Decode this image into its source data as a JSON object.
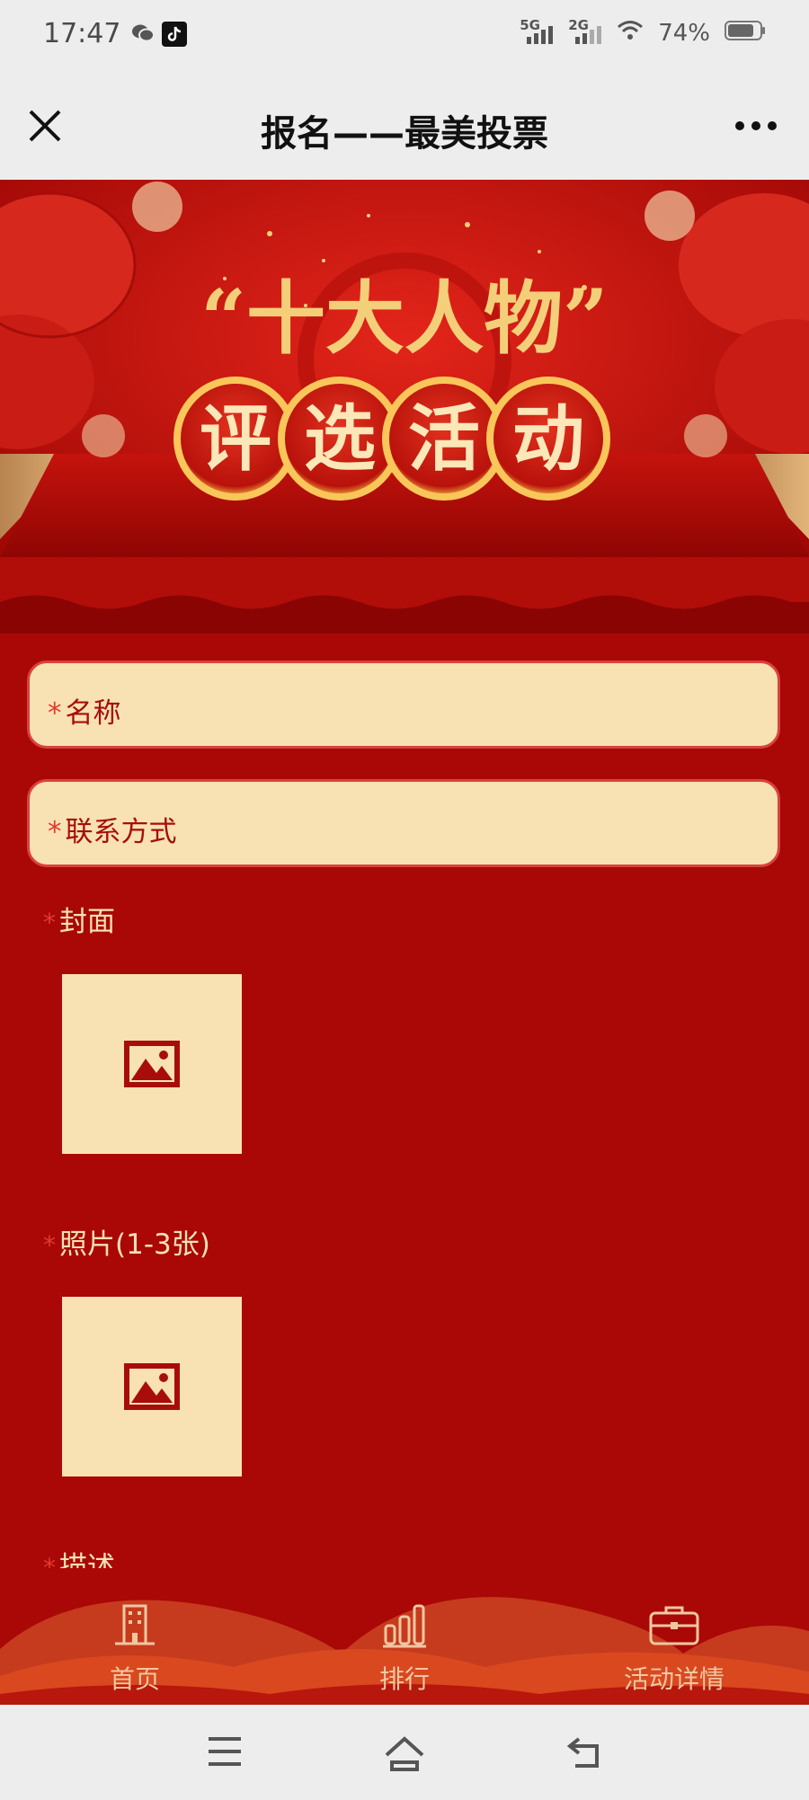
{
  "status_bar": {
    "time": "17:47",
    "network_1": "5G",
    "network_2": "2G",
    "battery": "74%",
    "icons": [
      "wechat-icon",
      "tiktok-icon",
      "signal-icon",
      "wifi-icon",
      "battery-icon"
    ]
  },
  "nav": {
    "title": "报名——最美投票",
    "close_icon": "close-icon",
    "more_icon": "more-icon"
  },
  "banner": {
    "title_line1": "“十大人物”",
    "title_line2": [
      "评",
      "选",
      "活",
      "动"
    ],
    "colors": {
      "red": "#c8140f",
      "gold": "#f4cf7a"
    }
  },
  "form": {
    "name_field": {
      "required": "*",
      "placeholder": "名称"
    },
    "contact_field": {
      "required": "*",
      "placeholder": "联系方式"
    },
    "cover": {
      "required": "*",
      "label": "封面"
    },
    "photos": {
      "required": "*",
      "label": "照片(1-3张)"
    },
    "description": {
      "required": "*",
      "label": "描述"
    }
  },
  "tabbar": {
    "items": [
      {
        "label": "首页",
        "icon": "building-icon"
      },
      {
        "label": "排行",
        "icon": "bar-chart-icon"
      },
      {
        "label": "活动详情",
        "icon": "briefcase-icon"
      }
    ]
  },
  "system_nav": {
    "icons": [
      "menu-icon",
      "home-icon",
      "back-icon"
    ]
  },
  "colors": {
    "page_bg": "#a90807",
    "field_bg": "#f8e2b4",
    "field_text": "#a80d0b",
    "label_text": "#f7e1b5",
    "required": "#e23a2e"
  }
}
